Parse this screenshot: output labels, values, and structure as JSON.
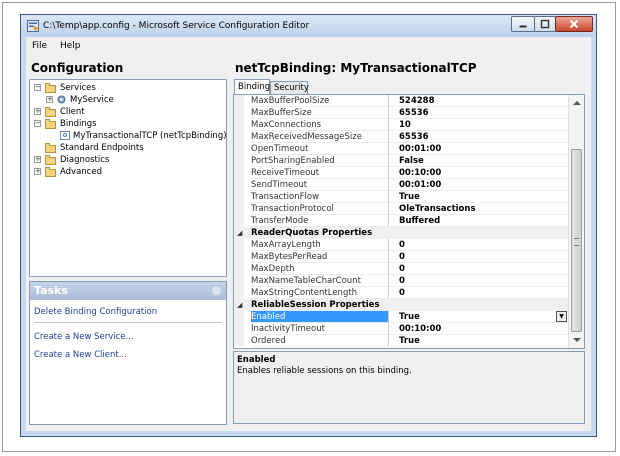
{
  "window": {
    "title": "C:\\Temp\\app.config - Microsoft Service Configuration Editor"
  },
  "menu": {
    "file": "File",
    "help": "Help"
  },
  "left": {
    "header": "Configuration",
    "tree": [
      {
        "label": "Services",
        "expander": "−"
      },
      {
        "label": "MyService",
        "expander": "+"
      },
      {
        "label": "Client",
        "expander": "+"
      },
      {
        "label": "Bindings",
        "expander": "−"
      },
      {
        "label": "MyTransactionalTCP (netTcpBinding)",
        "expander": ""
      },
      {
        "label": "Standard Endpoints",
        "expander": ""
      },
      {
        "label": "Diagnostics",
        "expander": "+"
      },
      {
        "label": "Advanced",
        "expander": "+"
      }
    ],
    "tasks": {
      "header": "Tasks",
      "links": [
        "Delete Binding Configuration",
        "Create a New Service...",
        "Create a New Client..."
      ]
    }
  },
  "right": {
    "header": "netTcpBinding: MyTransactionalTCP",
    "tabs": [
      "Binding",
      "Security"
    ],
    "rows": [
      {
        "name": "MaxBufferPoolSize",
        "value": "524288"
      },
      {
        "name": "MaxBufferSize",
        "value": "65536"
      },
      {
        "name": "MaxConnections",
        "value": "10"
      },
      {
        "name": "MaxReceivedMessageSize",
        "value": "65536"
      },
      {
        "name": "OpenTimeout",
        "value": "00:01:00"
      },
      {
        "name": "PortSharingEnabled",
        "value": "False"
      },
      {
        "name": "ReceiveTimeout",
        "value": "00:10:00"
      },
      {
        "name": "SendTimeout",
        "value": "00:01:00"
      },
      {
        "name": "TransactionFlow",
        "value": "True"
      },
      {
        "name": "TransactionProtocol",
        "value": "OleTransactions"
      },
      {
        "name": "TransferMode",
        "value": "Buffered"
      }
    ],
    "reader_quotas": {
      "category": "ReaderQuotas Properties",
      "rows": [
        {
          "name": "MaxArrayLength",
          "value": "0"
        },
        {
          "name": "MaxBytesPerRead",
          "value": "0"
        },
        {
          "name": "MaxDepth",
          "value": "0"
        },
        {
          "name": "MaxNameTableCharCount",
          "value": "0"
        },
        {
          "name": "MaxStringContentLength",
          "value": "0"
        }
      ]
    },
    "reliable_session": {
      "category": "ReliableSession Properties",
      "rows": [
        {
          "name": "Enabled",
          "value": "True"
        },
        {
          "name": "InactivityTimeout",
          "value": "00:10:00"
        },
        {
          "name": "Ordered",
          "value": "True"
        }
      ]
    },
    "description": {
      "title": "Enabled",
      "text": "Enables reliable sessions on this binding."
    }
  },
  "colors": {
    "selection": "#3399ff",
    "link": "#1f3f8f",
    "tasks_header": "#a9bcd8",
    "close_button": "#c9452e"
  }
}
